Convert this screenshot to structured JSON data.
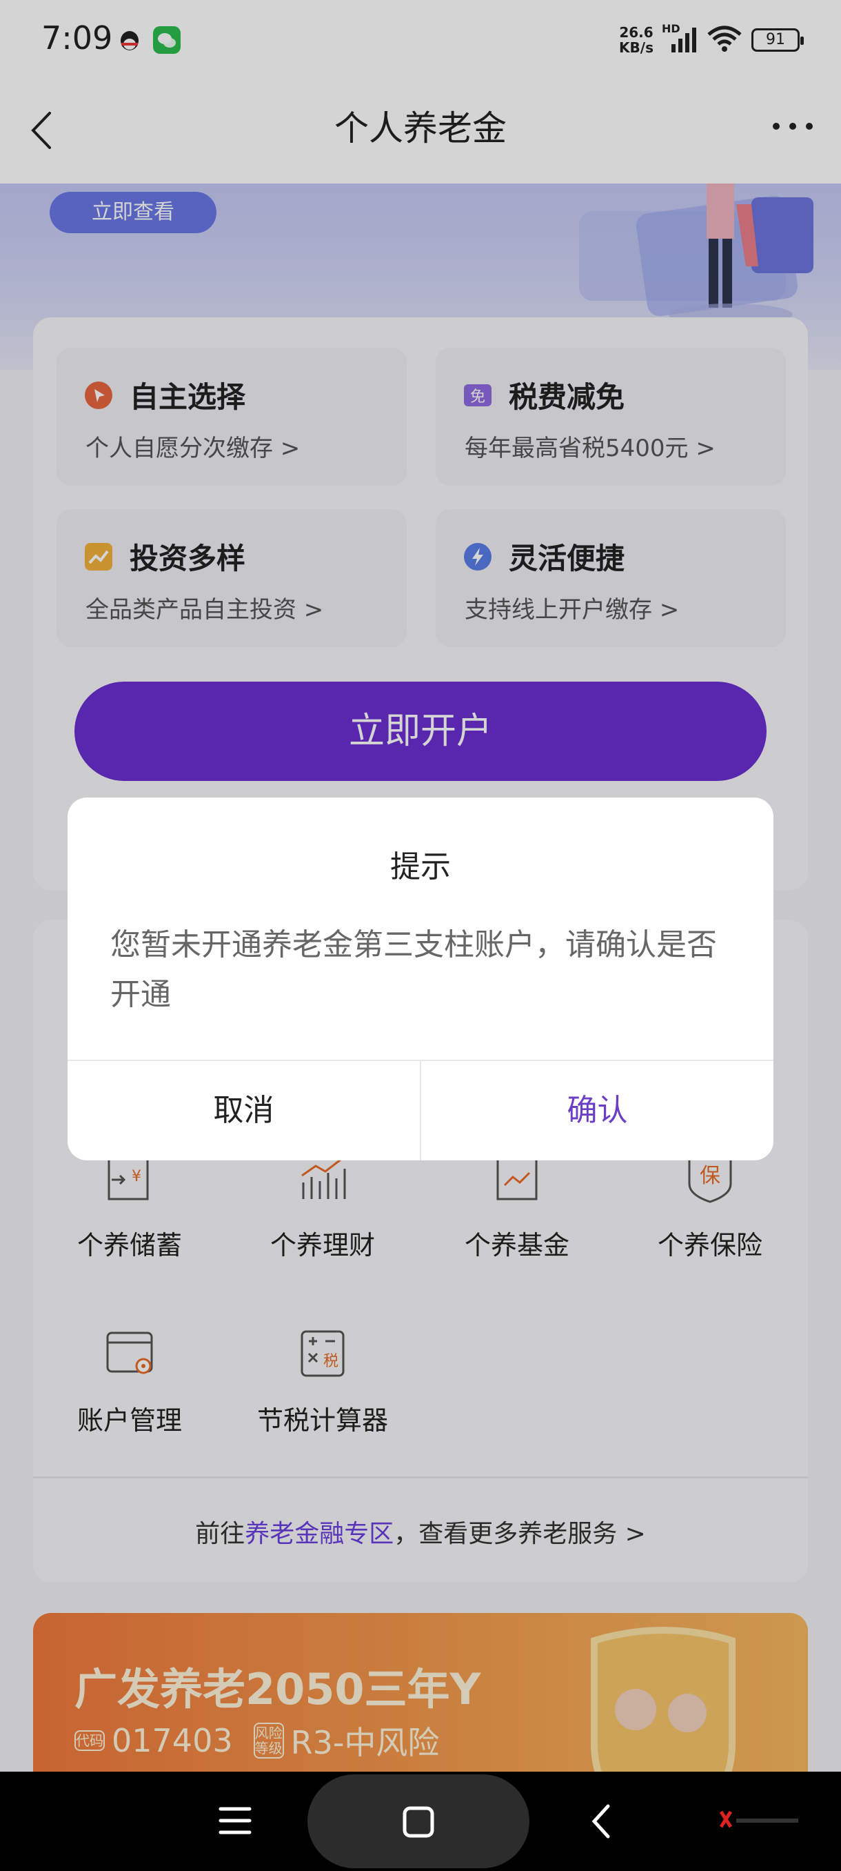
{
  "status_bar": {
    "time": "7:09",
    "net_speed_value": "26.6",
    "net_speed_unit": "KB/s",
    "network_badge": "HD",
    "battery": "91"
  },
  "nav": {
    "title": "个人养老金"
  },
  "banner": {
    "button_label": "立即查看"
  },
  "features": [
    {
      "title": "自主选择",
      "subtitle": "个人自愿分次缴存 >",
      "icon": "cursor-icon",
      "color": "#e8653e"
    },
    {
      "title": "税费减免",
      "subtitle": "每年最高省税5400元 >",
      "icon": "tax-free-icon",
      "color": "#8e6be0"
    },
    {
      "title": "投资多样",
      "subtitle": "全品类产品自主投资 >",
      "icon": "chart-icon",
      "color": "#f3b13b"
    },
    {
      "title": "灵活便捷",
      "subtitle": "支持线上开户缴存 >",
      "icon": "lightning-icon",
      "color": "#5b7ee8"
    }
  ],
  "features_icon_text": "免",
  "open_account_button": "立即开户",
  "services": {
    "items": [
      {
        "label": "个养储蓄",
        "icon": "savings-icon",
        "icon_text": "¥"
      },
      {
        "label": "个养理财",
        "icon": "wealth-chart-icon",
        "icon_text": ""
      },
      {
        "label": "个养基金",
        "icon": "fund-icon",
        "icon_text": ""
      },
      {
        "label": "个养保险",
        "icon": "insurance-shield-icon",
        "icon_text": "保"
      },
      {
        "label": "账户管理",
        "icon": "account-card-icon",
        "icon_text": ""
      },
      {
        "label": "节税计算器",
        "icon": "tax-calculator-icon",
        "icon_text": "税"
      }
    ],
    "link_prefix": "前往",
    "link_highlight": "养老金融专区",
    "link_suffix": "，查看更多养老服务 >"
  },
  "product": {
    "name": "广发养老2050三年Y",
    "code_tag": "代码",
    "code": "017403",
    "risk_tag": "风险等级",
    "risk": "R3-中风险"
  },
  "dialog": {
    "title": "提示",
    "message": "您暂未开通养老金第三支柱账户，请确认是否开通",
    "cancel": "取消",
    "confirm": "确认"
  },
  "colors": {
    "primary": "#6a2fd0",
    "link": "#6a3fe0",
    "confirm": "#6a3fc4",
    "service_icon_accent": "#e86a2a"
  }
}
